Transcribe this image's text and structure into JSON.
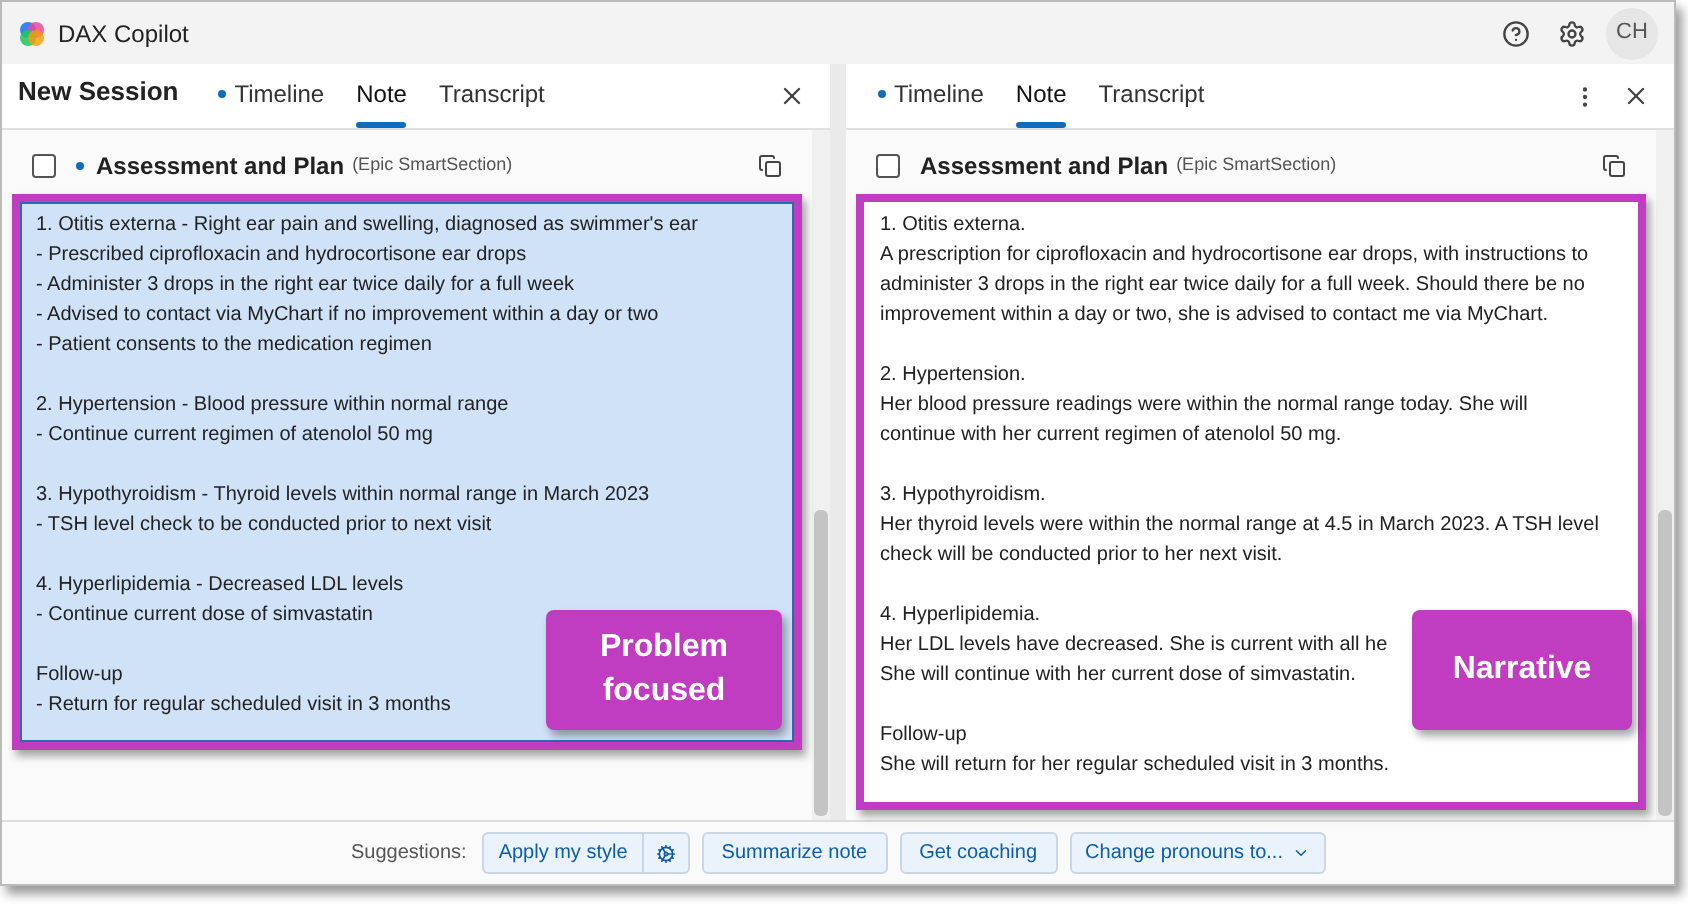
{
  "app": {
    "title": "DAX Copilot",
    "avatar": "CH"
  },
  "left_pane": {
    "session_title": "New Session",
    "more": false,
    "tabs": [
      {
        "label": "Timeline",
        "dot": true,
        "selected": false
      },
      {
        "label": "Note",
        "dot": false,
        "selected": true
      },
      {
        "label": "Transcript",
        "dot": false,
        "selected": false
      }
    ],
    "section": {
      "checked": false,
      "dot": true,
      "title": "Assessment and Plan",
      "subtitle": "(Epic SmartSection)"
    },
    "focused": true,
    "paragraphs": [
      [
        "1. Otitis externa - Right ear pain and swelling, diagnosed as swimmer's ear",
        "- Prescribed ciprofloxacin and hydrocortisone ear drops",
        "- Administer 3 drops in the right ear twice daily for a full week",
        "- Advised to contact via MyChart if no improvement within a day or two",
        "- Patient consents to the medication regimen"
      ],
      [
        "2. Hypertension - Blood pressure within normal range",
        "- Continue current regimen of atenolol 50 mg"
      ],
      [
        "3. Hypothyroidism - Thyroid levels within normal range in March 2023",
        "- TSH level check to be conducted prior to next visit"
      ],
      [
        "4. Hyperlipidemia - Decreased LDL levels",
        "- Continue current dose of simvastatin"
      ],
      [
        "Follow-up",
        "- Return for regular scheduled visit in 3 months"
      ]
    ],
    "callout": "Problem focused"
  },
  "right_pane": {
    "more": true,
    "tabs": [
      {
        "label": "Timeline",
        "dot": true,
        "selected": false
      },
      {
        "label": "Note",
        "dot": false,
        "selected": true
      },
      {
        "label": "Transcript",
        "dot": false,
        "selected": false
      }
    ],
    "section": {
      "checked": false,
      "dot": false,
      "title": "Assessment and Plan",
      "subtitle": "(Epic SmartSection)"
    },
    "focused": false,
    "paragraphs": [
      [
        "1. Otitis externa.",
        "A prescription for ciprofloxacin and hydrocortisone ear drops, with instructions to",
        "administer 3 drops in the right ear twice daily for a full week. Should there be no",
        "improvement within a day or two, she is advised to contact me via MyChart."
      ],
      [
        "2. Hypertension.",
        "Her blood pressure readings were within the normal range today. She will",
        "continue with her current regimen of atenolol 50 mg."
      ],
      [
        "3. Hypothyroidism.",
        "Her thyroid levels were within the normal range at 4.5 in March 2023. A TSH level",
        "check will be conducted prior to her next visit."
      ],
      [
        "4. Hyperlipidemia.",
        "Her LDL levels have decreased. She is current with all he",
        "She will continue with her current dose of simvastatin."
      ],
      [
        "Follow-up",
        "She will return for her regular scheduled visit in 3 months."
      ]
    ],
    "callout": "Narrative"
  },
  "suggestions": {
    "label": "Suggestions:",
    "buttons": [
      {
        "label": "Apply my style",
        "kind": "split"
      },
      {
        "label": "Summarize note",
        "kind": "plain"
      },
      {
        "label": "Get coaching",
        "kind": "plain"
      },
      {
        "label": "Change pronouns to...",
        "kind": "dropdown"
      }
    ]
  }
}
